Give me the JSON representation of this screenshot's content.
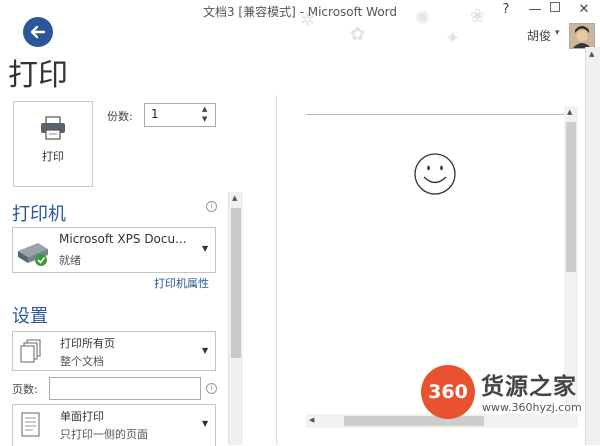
{
  "window": {
    "title": "文档3 [兼容模式] - Microsoft Word",
    "help_label": "?",
    "minimize_label": "—",
    "close_label": "✕",
    "user_name": "胡俊",
    "user_menu_arrow": "▾"
  },
  "page_title": "打印",
  "print_button": {
    "label": "打印",
    "icon": "printer-icon"
  },
  "copies": {
    "label": "份数:",
    "value": "1"
  },
  "printer_section": {
    "heading": "打印机",
    "info": "i",
    "selected_printer": "Microsoft XPS Docu...",
    "status": "就绪",
    "properties_link": "打印机属性"
  },
  "settings_section": {
    "heading": "设置",
    "print_range": {
      "title": "打印所有页",
      "subtitle": "整个文档"
    },
    "pages_label": "页数:",
    "pages_value": "",
    "sides": {
      "title": "单面打印",
      "subtitle": "只打印一侧的页面"
    }
  },
  "watermark": {
    "logo_text": "360",
    "brand": "货源之家",
    "url": "www.360hyzj.com"
  },
  "colors": {
    "accent": "#2b579a",
    "watermark": "#e8522f"
  }
}
